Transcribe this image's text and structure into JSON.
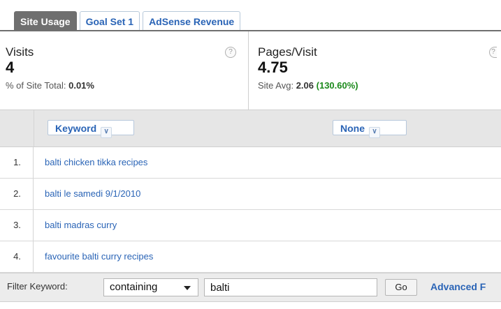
{
  "tabs": [
    {
      "label": "Site Usage",
      "active": true
    },
    {
      "label": "Goal Set 1",
      "active": false
    },
    {
      "label": "AdSense Revenue",
      "active": false
    }
  ],
  "metrics": {
    "visits": {
      "title": "Visits",
      "value": "4",
      "sub_label": "% of Site Total:",
      "sub_value": "0.01%",
      "help": "?"
    },
    "pages_per_visit": {
      "title": "Pages/Visit",
      "value": "4.75",
      "sub_label": "Site Avg:",
      "sub_value": "2.06",
      "sub_pct": "(130.60%)",
      "help": "?"
    }
  },
  "table": {
    "primary_dimension": "Keyword",
    "secondary_dimension": "None",
    "dropdown_icon": "∨",
    "rows": [
      {
        "num": "1.",
        "keyword": "balti chicken tikka recipes"
      },
      {
        "num": "2.",
        "keyword": "balti le samedi 9/1/2010"
      },
      {
        "num": "3.",
        "keyword": "balti madras curry"
      },
      {
        "num": "4.",
        "keyword": "favourite balti curry recipes"
      }
    ]
  },
  "filter": {
    "label": "Filter Keyword:",
    "mode": "containing",
    "value": "balti",
    "go_label": "Go",
    "advanced_label": "Advanced F"
  },
  "colors": {
    "link": "#2a64b6",
    "active_tab": "#6f6f6f",
    "positive": "#1c8a1c"
  }
}
